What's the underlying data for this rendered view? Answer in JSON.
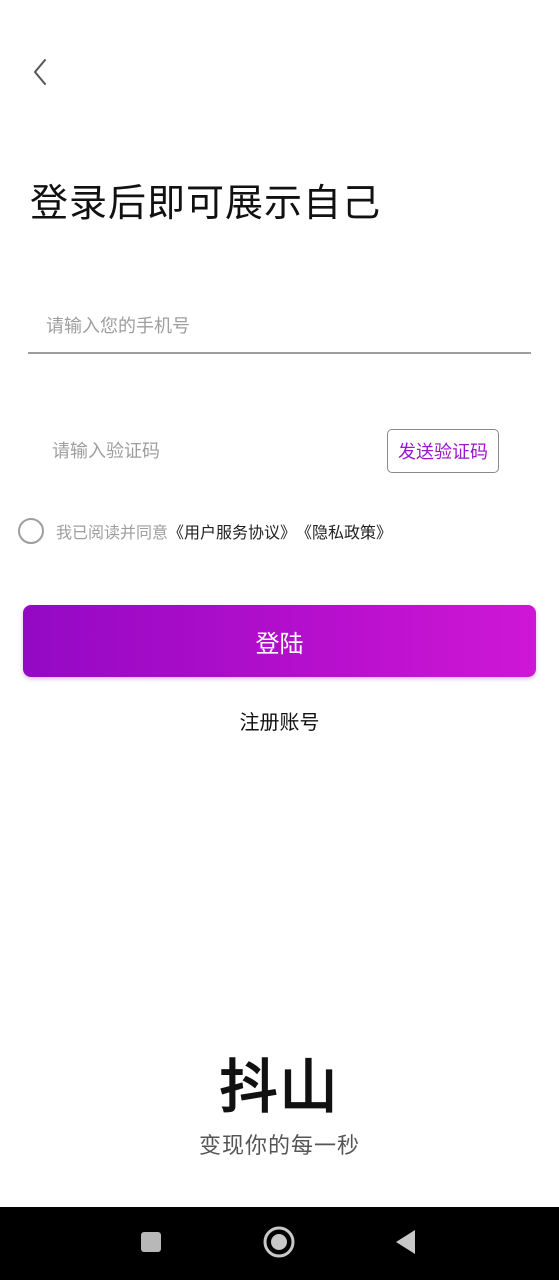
{
  "header": {
    "back_icon": "chevron-left-icon",
    "title": "登录后即可展示自己"
  },
  "form": {
    "phone_placeholder": "请输入您的手机号",
    "phone_value": "",
    "code_placeholder": "请输入验证码",
    "code_value": "",
    "send_code_label": "发送验证码",
    "agreement_checked": false,
    "agreement_prefix": "我已阅读并同意",
    "user_agreement_link": "《用户服务协议》",
    "privacy_link": "《隐私政策》",
    "login_label": "登陆",
    "register_label": "注册账号"
  },
  "brand": {
    "logo_text": "抖山",
    "slogan": "变现你的每一秒"
  },
  "colors": {
    "accent": "#9b15c9",
    "button_gradient_start": "#9409c4",
    "button_gradient_end": "#cf17d6",
    "navbar": "#000000"
  },
  "navbar": {
    "recents_icon": "square-icon",
    "home_icon": "circle-home-icon",
    "back_icon": "triangle-back-icon"
  }
}
